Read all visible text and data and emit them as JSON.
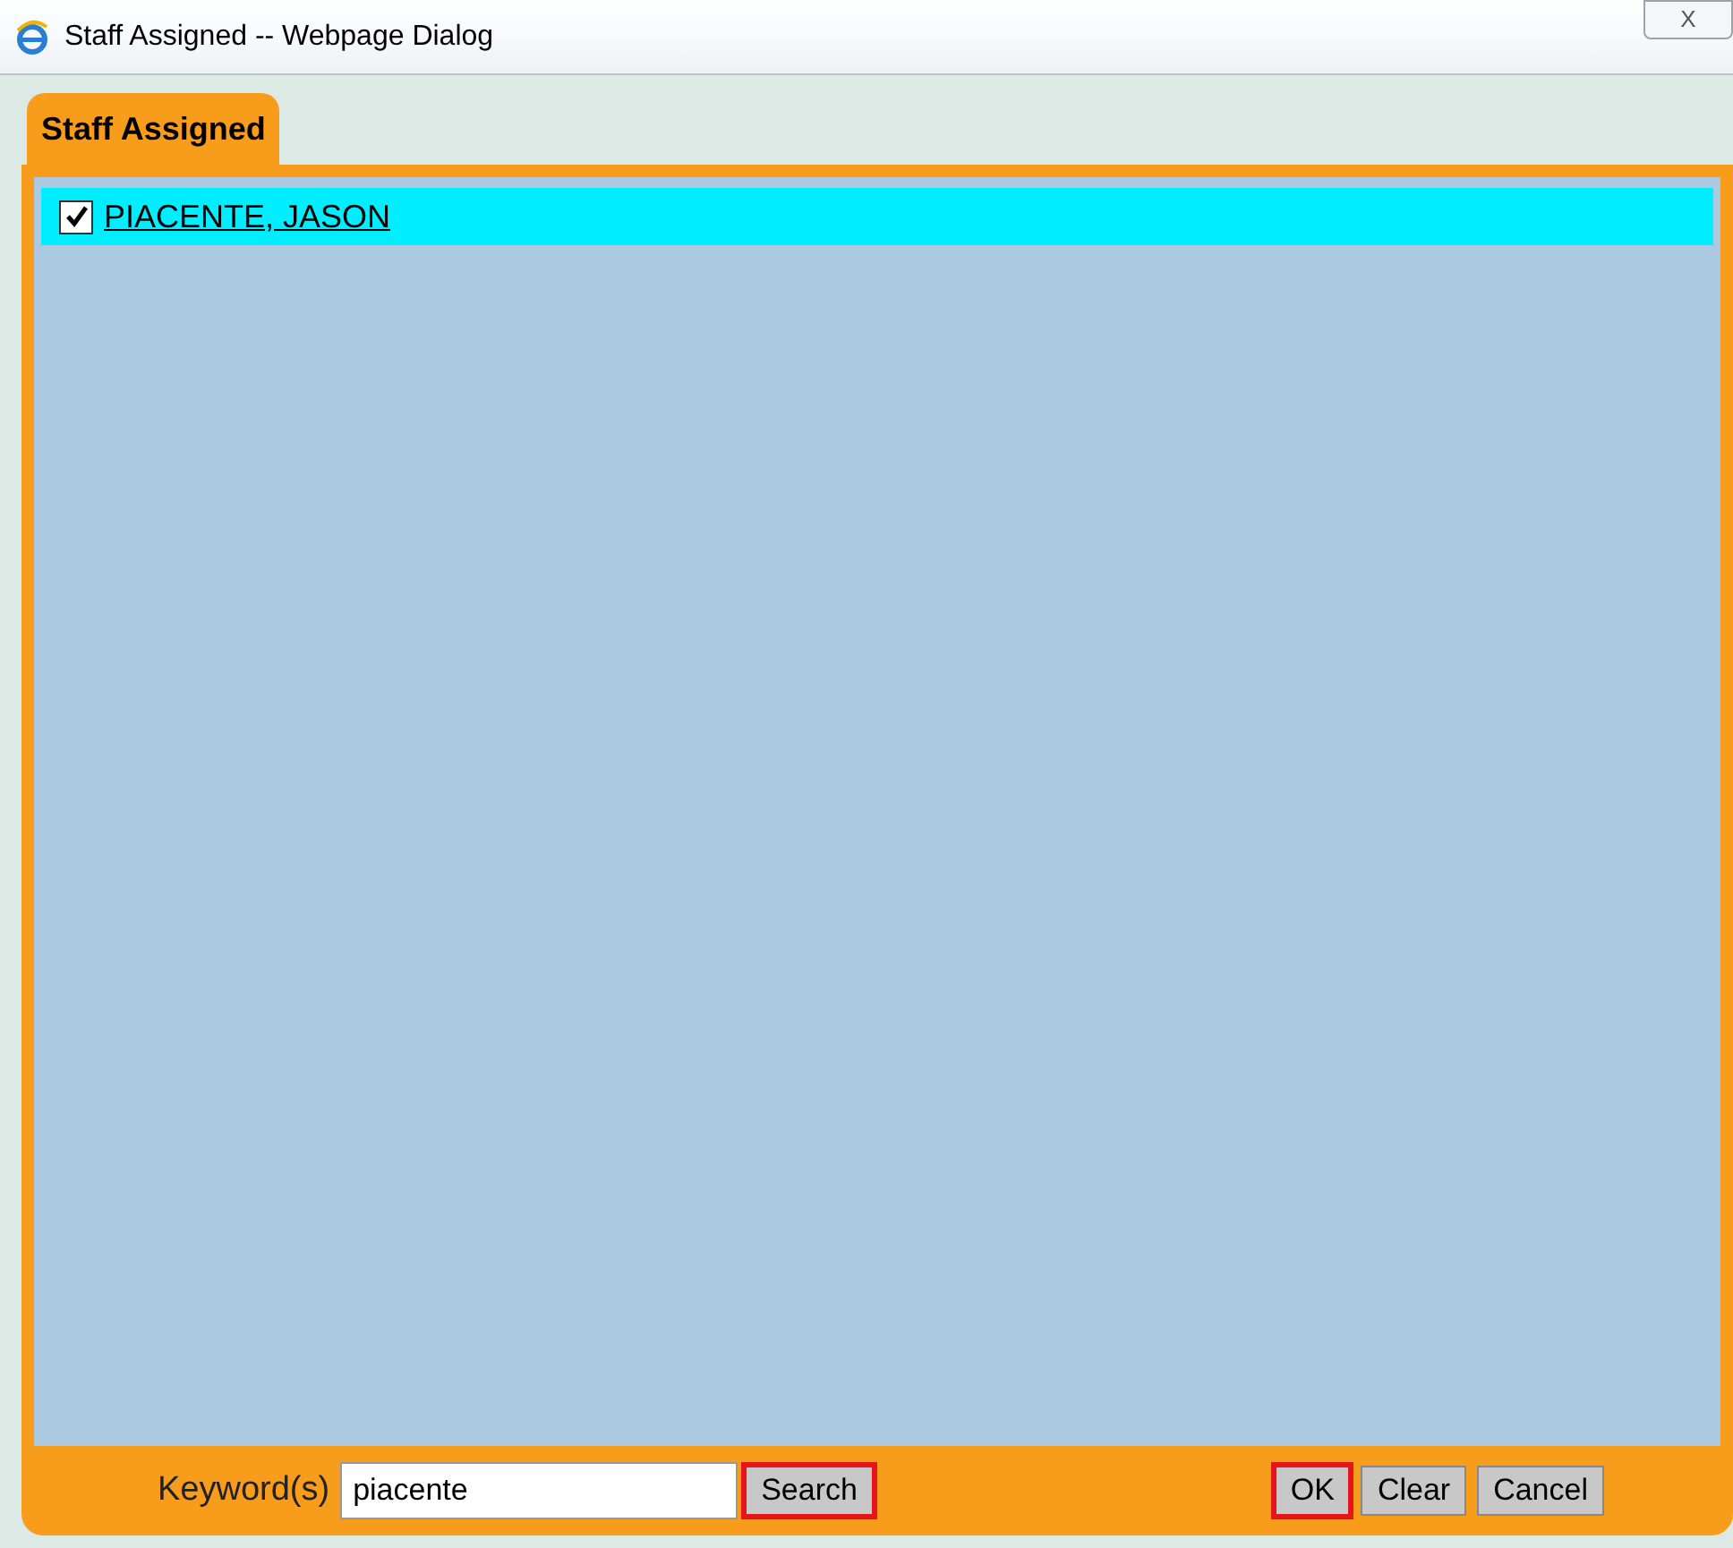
{
  "window": {
    "title": "Staff Assigned -- Webpage Dialog",
    "close": "X"
  },
  "tabs": [
    {
      "label": "Staff Assigned",
      "selected": true
    }
  ],
  "staff": [
    {
      "name": "PIACENTE, JASON",
      "checked": true,
      "selected": true
    }
  ],
  "search": {
    "label": "Keyword(s)",
    "value": "piacente",
    "button": {
      "label": "Search",
      "highlighted": true
    }
  },
  "buttons": [
    {
      "label": "OK",
      "highlighted": true
    },
    {
      "label": "Clear",
      "highlighted": false
    },
    {
      "label": "Cancel",
      "highlighted": false
    }
  ]
}
